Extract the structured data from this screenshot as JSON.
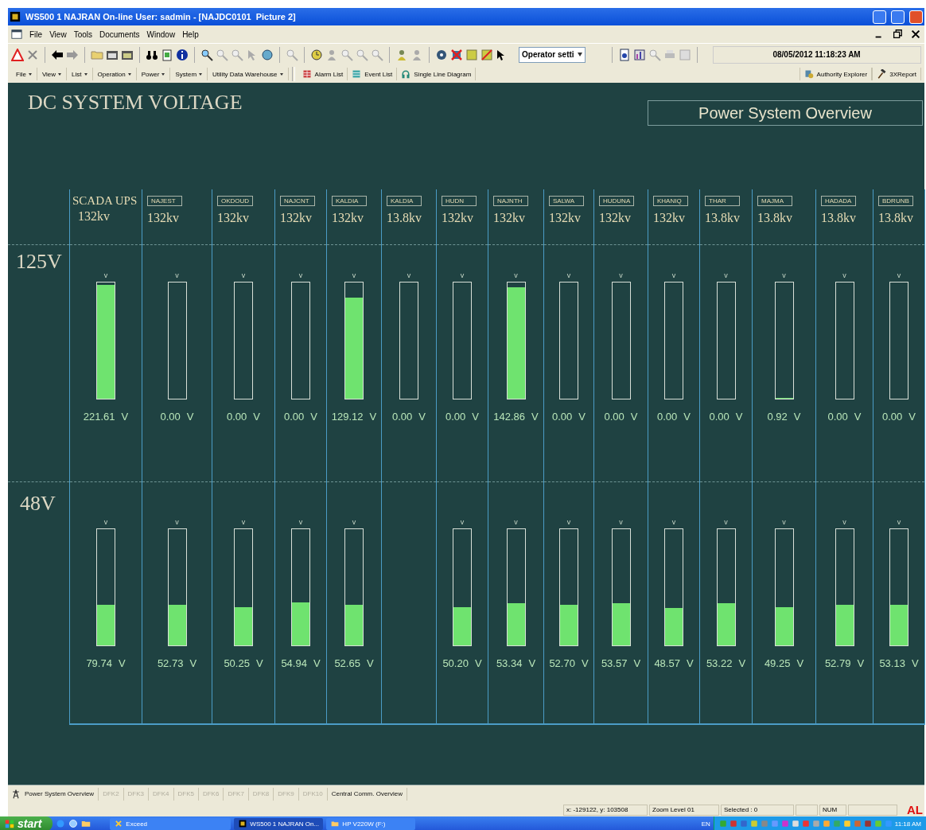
{
  "window": {
    "title": "WS500 1 NAJRAN On-line User: sadmin - [NAJDC0101",
    "title_suffix": "Picture 2]"
  },
  "menu": [
    "File",
    "View",
    "Tools",
    "Documents",
    "Window",
    "Help"
  ],
  "toolbar": {
    "operator_select": {
      "value": "Operator setti"
    },
    "clock": "08/05/2012 11:18:23 AM"
  },
  "nav_toolbar": {
    "menus": [
      "File",
      "View",
      "List",
      "Operation",
      "Power",
      "System",
      "Utility Data Warehouse"
    ],
    "buttons": [
      "Alarm List",
      "Event List",
      "Single Line Diagram"
    ],
    "right_buttons": [
      "Authority Explorer",
      "3XReport"
    ]
  },
  "display": {
    "title": "DC SYSTEM VOLTAGE",
    "overview_button": "Power System Overview",
    "row_labels": [
      "125V",
      "48V"
    ],
    "columns": [
      {
        "kind": "plain",
        "name": "SCADA UPS",
        "rating": "132kv",
        "v125": {
          "marker": "v",
          "level": 0.98,
          "reading": "221.61",
          "unit": "V"
        },
        "v48": {
          "marker": "v",
          "level": 0.35,
          "reading": "79.74",
          "unit": "V"
        }
      },
      {
        "kind": "boxed",
        "name": "NAJEST",
        "rating": "132kv",
        "v125": {
          "marker": "v",
          "reading": "0.00",
          "unit": "V"
        },
        "v48": {
          "marker": "v",
          "level": 0.35,
          "reading": "52.73",
          "unit": "V"
        }
      },
      {
        "kind": "boxed",
        "name": "OKDOUD",
        "rating": "132kv",
        "v125": {
          "marker": "v",
          "reading": "0.00",
          "unit": "V"
        },
        "v48": {
          "marker": "v",
          "level": 0.33,
          "reading": "50.25",
          "unit": "V"
        }
      },
      {
        "kind": "boxed",
        "name": "NAJCNT",
        "rating": "132kv",
        "v125": {
          "marker": "v",
          "reading": "0.00",
          "unit": "V"
        },
        "v48": {
          "marker": "v",
          "level": 0.37,
          "reading": "54.94",
          "unit": "V"
        }
      },
      {
        "kind": "boxed",
        "name": "KALDIA",
        "rating": "132kv",
        "v125": {
          "marker": "v",
          "level": 0.87,
          "reading": "129.12",
          "unit": "V"
        },
        "v48": {
          "marker": "v",
          "level": 0.35,
          "reading": "52.65",
          "unit": "V"
        }
      },
      {
        "kind": "boxed",
        "name": "KALDIA",
        "rating": "13.8kv",
        "v125": {
          "marker": "v",
          "reading": "0.00",
          "unit": "V"
        }
      },
      {
        "kind": "boxed",
        "name": "HUDN",
        "rating": "132kv",
        "v125": {
          "marker": "v",
          "reading": "0.00",
          "unit": "V"
        },
        "v48": {
          "marker": "v",
          "level": 0.33,
          "reading": "50.20",
          "unit": "V"
        }
      },
      {
        "kind": "boxed",
        "name": "NAJNTH",
        "rating": "132kv",
        "v125": {
          "marker": "v",
          "level": 0.96,
          "reading": "142.86",
          "unit": "V"
        },
        "v48": {
          "marker": "v",
          "level": 0.36,
          "reading": "53.34",
          "unit": "V"
        }
      },
      {
        "kind": "boxed",
        "name": "SALWA",
        "rating": "132kv",
        "v125": {
          "marker": "v",
          "reading": "0.00",
          "unit": "V"
        },
        "v48": {
          "marker": "v",
          "level": 0.35,
          "reading": "52.70",
          "unit": "V"
        }
      },
      {
        "kind": "boxed",
        "name": "HUDUNA",
        "rating": "132kv",
        "v125": {
          "marker": "v",
          "reading": "0.00",
          "unit": "V"
        },
        "v48": {
          "marker": "v",
          "level": 0.36,
          "reading": "53.57",
          "unit": "V"
        }
      },
      {
        "kind": "boxed",
        "name": "KHANIQ",
        "rating": "132kv",
        "v125": {
          "marker": "v",
          "reading": "0.00",
          "unit": "V"
        },
        "v48": {
          "marker": "v",
          "level": 0.32,
          "reading": "48.57",
          "unit": "V"
        }
      },
      {
        "kind": "boxed",
        "name": "THAR",
        "rating": "13.8kv",
        "v125": {
          "marker": "v",
          "reading": "0.00",
          "unit": "V"
        },
        "v48": {
          "marker": "v",
          "level": 0.36,
          "reading": "53.22",
          "unit": "V"
        }
      },
      {
        "kind": "boxed",
        "name": "MAJMA",
        "rating": "13.8kv",
        "v125": {
          "marker": "v",
          "level": 0.01,
          "reading": "0.92",
          "unit": "V"
        },
        "v48": {
          "marker": "v",
          "level": 0.33,
          "reading": "49.25",
          "unit": "V"
        }
      },
      {
        "kind": "boxed",
        "name": "HADADA",
        "rating": "13.8kv",
        "v125": {
          "marker": "v",
          "reading": "0.00",
          "unit": "V"
        },
        "v48": {
          "marker": "v",
          "level": 0.35,
          "reading": "52.79",
          "unit": "V"
        }
      },
      {
        "kind": "boxed",
        "name": "BDRUNB",
        "rating": "13.8kv",
        "v125": {
          "marker": "v",
          "reading": "0.00",
          "unit": "V"
        },
        "v48": {
          "marker": "v",
          "level": 0.35,
          "reading": "53.13",
          "unit": "V"
        }
      }
    ]
  },
  "display_tabs": [
    {
      "label": "Power System Overview",
      "disabled": false
    },
    {
      "label": "DFK2",
      "disabled": true
    },
    {
      "label": "DFK3",
      "disabled": true
    },
    {
      "label": "DFK4",
      "disabled": true
    },
    {
      "label": "DFK5",
      "disabled": true
    },
    {
      "label": "DFK6",
      "disabled": true
    },
    {
      "label": "DFK7",
      "disabled": true
    },
    {
      "label": "DFK8",
      "disabled": true
    },
    {
      "label": "DFK9",
      "disabled": true
    },
    {
      "label": "DFK10",
      "disabled": true
    },
    {
      "label": "Central Comm. Overview",
      "disabled": false
    }
  ],
  "status_bar": {
    "fields": [
      "x: -129122, y: 103508",
      "Zoom Level 01",
      "Selected : 0",
      "NUM"
    ],
    "logo": "AL"
  },
  "taskbar": {
    "start": "start",
    "tasks": [
      "Exceed",
      "WS500 1 NAJRAN On...",
      "HP V220W (F:)"
    ],
    "language": "EN",
    "time": "11:18 AM"
  }
}
